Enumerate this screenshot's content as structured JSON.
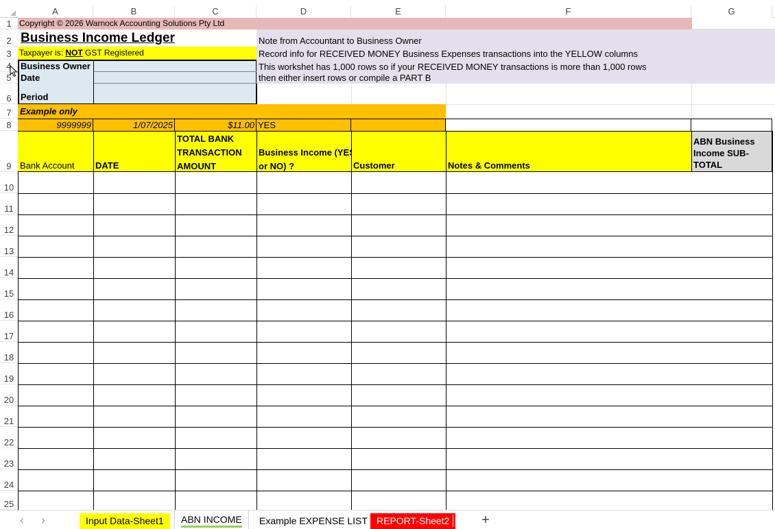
{
  "columns": [
    "A",
    "B",
    "C",
    "D",
    "E",
    "F",
    "G"
  ],
  "rows": [
    "1",
    "2",
    "3",
    "4",
    "5",
    "6",
    "7",
    "8",
    "9",
    "10",
    "11",
    "12",
    "13",
    "14",
    "15",
    "16",
    "17",
    "18",
    "19",
    "20",
    "21",
    "22",
    "23",
    "24",
    "25"
  ],
  "header_block": {
    "copyright": "Copyright © 2026 Warnock Accounting Solutions Pty Ltd",
    "title": "Business Income Ledger",
    "taxpayer_prefix": "Taxpayer is: ",
    "taxpayer_not": " NOT",
    "taxpayer_suffix": " GST Registered",
    "business_owner_label": "Business Owner",
    "date_label": "Date",
    "period_label": "Period"
  },
  "note": {
    "line1": "Note from Accountant to Business Owner",
    "line2": "Record info for RECEIVED MONEY Business Expenses transactions into the YELLOW columns",
    "line3": "This workshet has 1,000 rows so if your RECEIVED MONEY transactions is more than 1,000 rows",
    "line4": "then either insert rows or compile a PART B"
  },
  "example": {
    "label": "Example only",
    "account": "9999999",
    "date": "1/07/2025",
    "amount": "$11.00",
    "business_income": "YES"
  },
  "table_headers": {
    "bank_account": "Bank Account",
    "date": "DATE",
    "total_line1": "TOTAL BANK",
    "total_line2": "TRANSACTION",
    "total_line3": "AMOUNT",
    "business_income_line1": "Business Income (YES",
    "business_income_line2": "or NO) ?",
    "customer": "Customer",
    "notes": "Notes & Comments",
    "subtotal_line1": "ABN Business",
    "subtotal_line2": "Income SUB-",
    "subtotal_line3": "TOTAL"
  },
  "sheet_tabs": [
    {
      "label": "Input Data-Sheet1"
    },
    {
      "label": "ABN INCOME"
    },
    {
      "label": "Example EXPENSE LIST"
    },
    {
      "label": "REPORT-Sheet2"
    }
  ],
  "add_sheet": "+",
  "nav_prev": "‹",
  "nav_next": "›",
  "colors": {
    "pink": "#e6b8b7",
    "yellow": "#ffff00",
    "lightblue": "#dce9f1",
    "lavender": "#e4dfec",
    "orange": "#ffc000",
    "grey": "#d9d9d9",
    "tab_active": "#92d050",
    "tab_report": "#ff0000"
  }
}
